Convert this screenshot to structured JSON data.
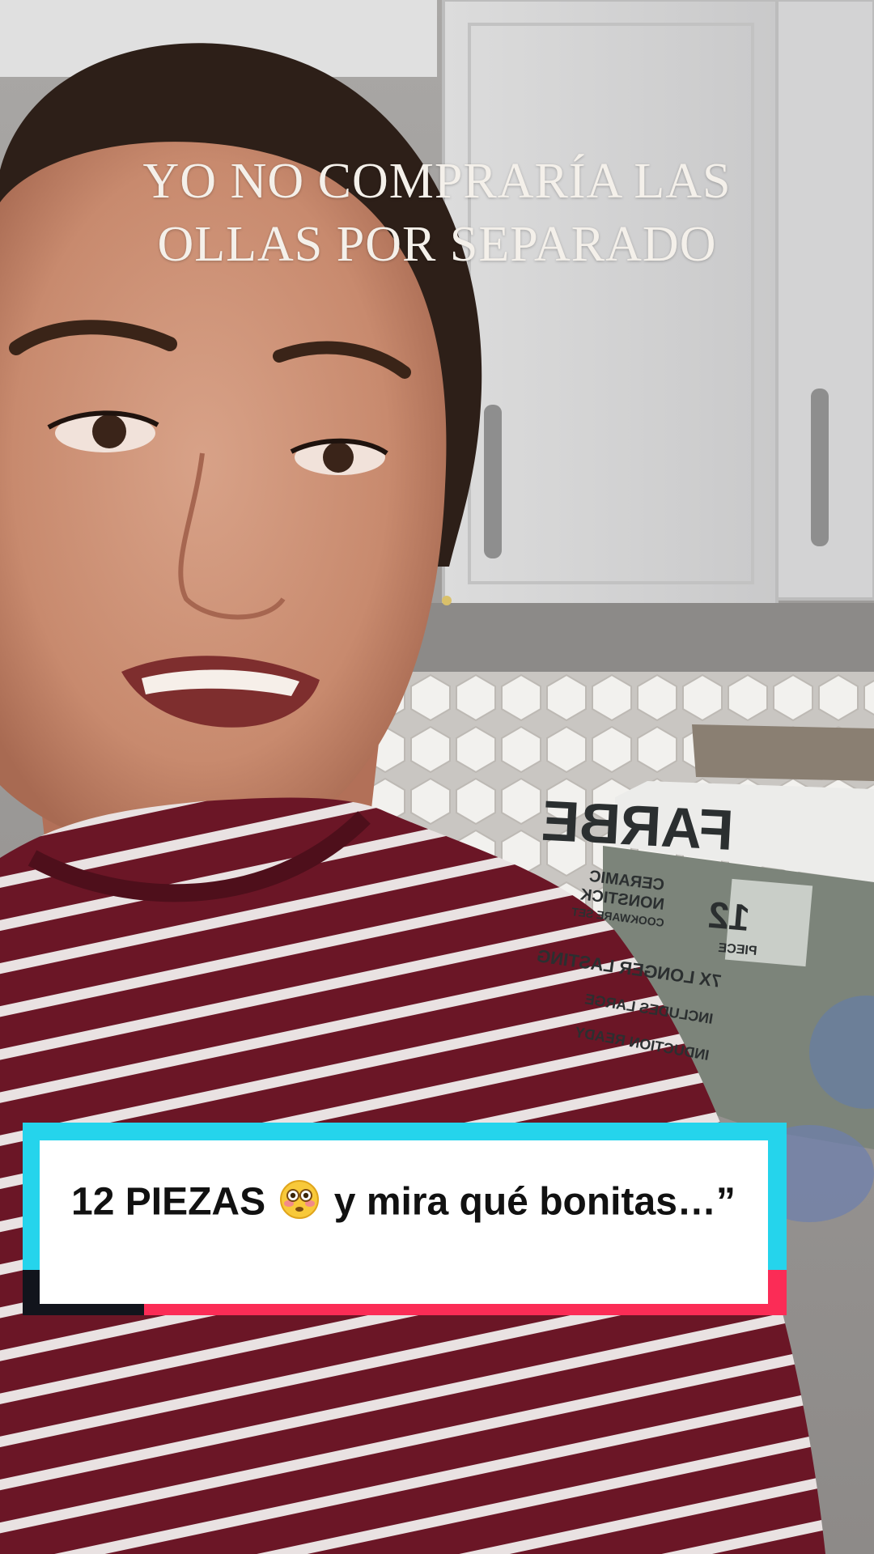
{
  "overlay": {
    "line1": "YO NO COMPRARÍA LAS",
    "line2": "OLLAS POR SEPARADO"
  },
  "caption": {
    "before_emoji": "12 PIEZAS",
    "emoji": "flushed-face-emoji",
    "after_emoji": "y mira qué bonitas…”"
  },
  "product_box": {
    "brand": "FARBE",
    "count": "12",
    "count_label": "PIECE",
    "line1": "CERAMIC",
    "line2": "NONSTICK",
    "line3": "COOKWARE SET",
    "feature1": "7X LONGER LASTING",
    "feature2": "INCLUDES LARGE",
    "feature3": "INDUCTION READY"
  },
  "colors": {
    "sticker_cyan": "#25d4ec",
    "sticker_pink": "#fb2c56",
    "sticker_black": "#12141c",
    "shirt_maroon": "#6b1626",
    "cabinet_white": "#d9d9d9"
  }
}
